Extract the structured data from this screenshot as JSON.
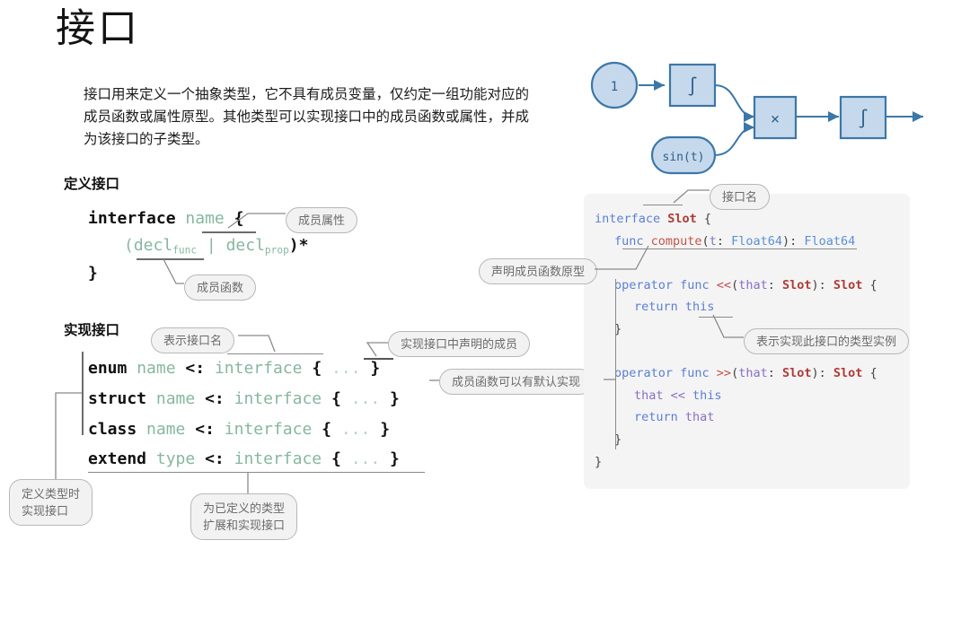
{
  "page": {
    "title": "接口",
    "intro": "接口用来定义一个抽象类型，它不具有成员变量，仅约定一组功能对应的成员函数或属性原型。其他类型可以实现接口中的成员函数或属性，并成为该接口的子类型。",
    "heading_define": "定义接口",
    "heading_implement": "实现接口"
  },
  "define_syntax": {
    "line1_kw": "interface",
    "line1_name": "name",
    "line1_brace": "{",
    "line2": "(decl",
    "line2_sub1": "func",
    "line2_mid": " | decl",
    "line2_sub2": "prop",
    "line2_end": ")*",
    "line3": "}"
  },
  "implement_syntax": {
    "rows": [
      {
        "kw": "enum",
        "name": "name",
        "op": "<:",
        "iface": "interface",
        "body_open": "{",
        "dots": "...",
        "body_close": "}"
      },
      {
        "kw": "struct",
        "name": "name",
        "op": "<:",
        "iface": "interface",
        "body_open": "{",
        "dots": "...",
        "body_close": "}"
      },
      {
        "kw": "class",
        "name": "name",
        "op": "<:",
        "iface": "interface",
        "body_open": "{",
        "dots": "...",
        "body_close": "}"
      },
      {
        "kw": "extend",
        "name": "type",
        "op": "<:",
        "iface": "interface",
        "body_open": "{",
        "dots": "...",
        "body_close": "}"
      }
    ]
  },
  "callouts": {
    "member_property": "成员属性",
    "member_function": "成员函数",
    "means_interface_name": "表示接口名",
    "implements_declared_members": "实现接口中声明的成员",
    "member_func_default_impl": "成员函数可以有默认实现",
    "define_type_implement": "定义类型时\n实现接口",
    "extend_existing_type": "为已定义的类型\n扩展和实现接口",
    "interface_name": "接口名",
    "declare_member_func_prototype": "声明成员函数原型",
    "instance_of_implementing_type": "表示实现此接口的类型实例"
  },
  "code_panel": {
    "lines": [
      {
        "indent": 0,
        "tokens": [
          {
            "t": "interface ",
            "c": "kw"
          },
          {
            "t": "Slot",
            "c": "type-strong"
          },
          {
            "t": " {",
            "c": "plain"
          }
        ]
      },
      {
        "indent": 1,
        "tokens": [
          {
            "t": "func ",
            "c": "kw"
          },
          {
            "t": "compute",
            "c": "fn"
          },
          {
            "t": "(",
            "c": "plain"
          },
          {
            "t": "t",
            "c": "param"
          },
          {
            "t": ": ",
            "c": "plain"
          },
          {
            "t": "Float64",
            "c": "type"
          },
          {
            "t": "): ",
            "c": "plain"
          },
          {
            "t": "Float64",
            "c": "type"
          }
        ]
      },
      {
        "indent": 0,
        "tokens": []
      },
      {
        "indent": 1,
        "tokens": [
          {
            "t": "operator func ",
            "c": "kw"
          },
          {
            "t": "<<",
            "c": "op"
          },
          {
            "t": "(",
            "c": "plain"
          },
          {
            "t": "that",
            "c": "param"
          },
          {
            "t": ": ",
            "c": "plain"
          },
          {
            "t": "Slot",
            "c": "type-strong"
          },
          {
            "t": "): ",
            "c": "plain"
          },
          {
            "t": "Slot",
            "c": "type-strong"
          },
          {
            "t": " {",
            "c": "plain"
          }
        ]
      },
      {
        "indent": 2,
        "tokens": [
          {
            "t": "return ",
            "c": "kw"
          },
          {
            "t": "this",
            "c": "this"
          }
        ]
      },
      {
        "indent": 1,
        "tokens": [
          {
            "t": "}",
            "c": "plain"
          }
        ]
      },
      {
        "indent": 0,
        "tokens": []
      },
      {
        "indent": 1,
        "tokens": [
          {
            "t": "operator func ",
            "c": "kw"
          },
          {
            "t": ">>",
            "c": "op"
          },
          {
            "t": "(",
            "c": "plain"
          },
          {
            "t": "that",
            "c": "param"
          },
          {
            "t": ": ",
            "c": "plain"
          },
          {
            "t": "Slot",
            "c": "type-strong"
          },
          {
            "t": "): ",
            "c": "plain"
          },
          {
            "t": "Slot",
            "c": "type-strong"
          },
          {
            "t": " {",
            "c": "plain"
          }
        ]
      },
      {
        "indent": 2,
        "tokens": [
          {
            "t": "that",
            "c": "param"
          },
          {
            "t": " << ",
            "c": "op2"
          },
          {
            "t": "this",
            "c": "this"
          }
        ]
      },
      {
        "indent": 2,
        "tokens": [
          {
            "t": "return ",
            "c": "kw"
          },
          {
            "t": "that",
            "c": "param"
          }
        ]
      },
      {
        "indent": 1,
        "tokens": [
          {
            "t": "}",
            "c": "plain"
          }
        ]
      },
      {
        "indent": 0,
        "tokens": [
          {
            "t": "}",
            "c": "plain"
          }
        ]
      }
    ]
  },
  "flow_diagram": {
    "nodes": [
      {
        "id": "one",
        "label": "1",
        "shape": "circle"
      },
      {
        "id": "int1",
        "label": "∫",
        "shape": "rect"
      },
      {
        "id": "sin",
        "label": "sin(t)",
        "shape": "pill"
      },
      {
        "id": "mul",
        "label": "×",
        "shape": "rect"
      },
      {
        "id": "int2",
        "label": "∫",
        "shape": "rect"
      }
    ],
    "edges": [
      {
        "from": "one",
        "to": "int1"
      },
      {
        "from": "int1",
        "to": "mul"
      },
      {
        "from": "sin",
        "to": "mul"
      },
      {
        "from": "mul",
        "to": "int2"
      },
      {
        "from": "int2",
        "to": "out"
      }
    ]
  },
  "colors": {
    "accent_green": "#87b79f",
    "code_blue": "#5b7fd4",
    "code_red": "#b03a36",
    "code_purple": "#8a6fc4",
    "diagram_stroke": "#3c77a8",
    "diagram_fill": "#c6d9ec",
    "panel_bg": "#f4f4f4",
    "bubble_bg": "#f2f2f2",
    "bubble_border": "#b8b8b8",
    "bubble_text": "#6b6b6b"
  }
}
